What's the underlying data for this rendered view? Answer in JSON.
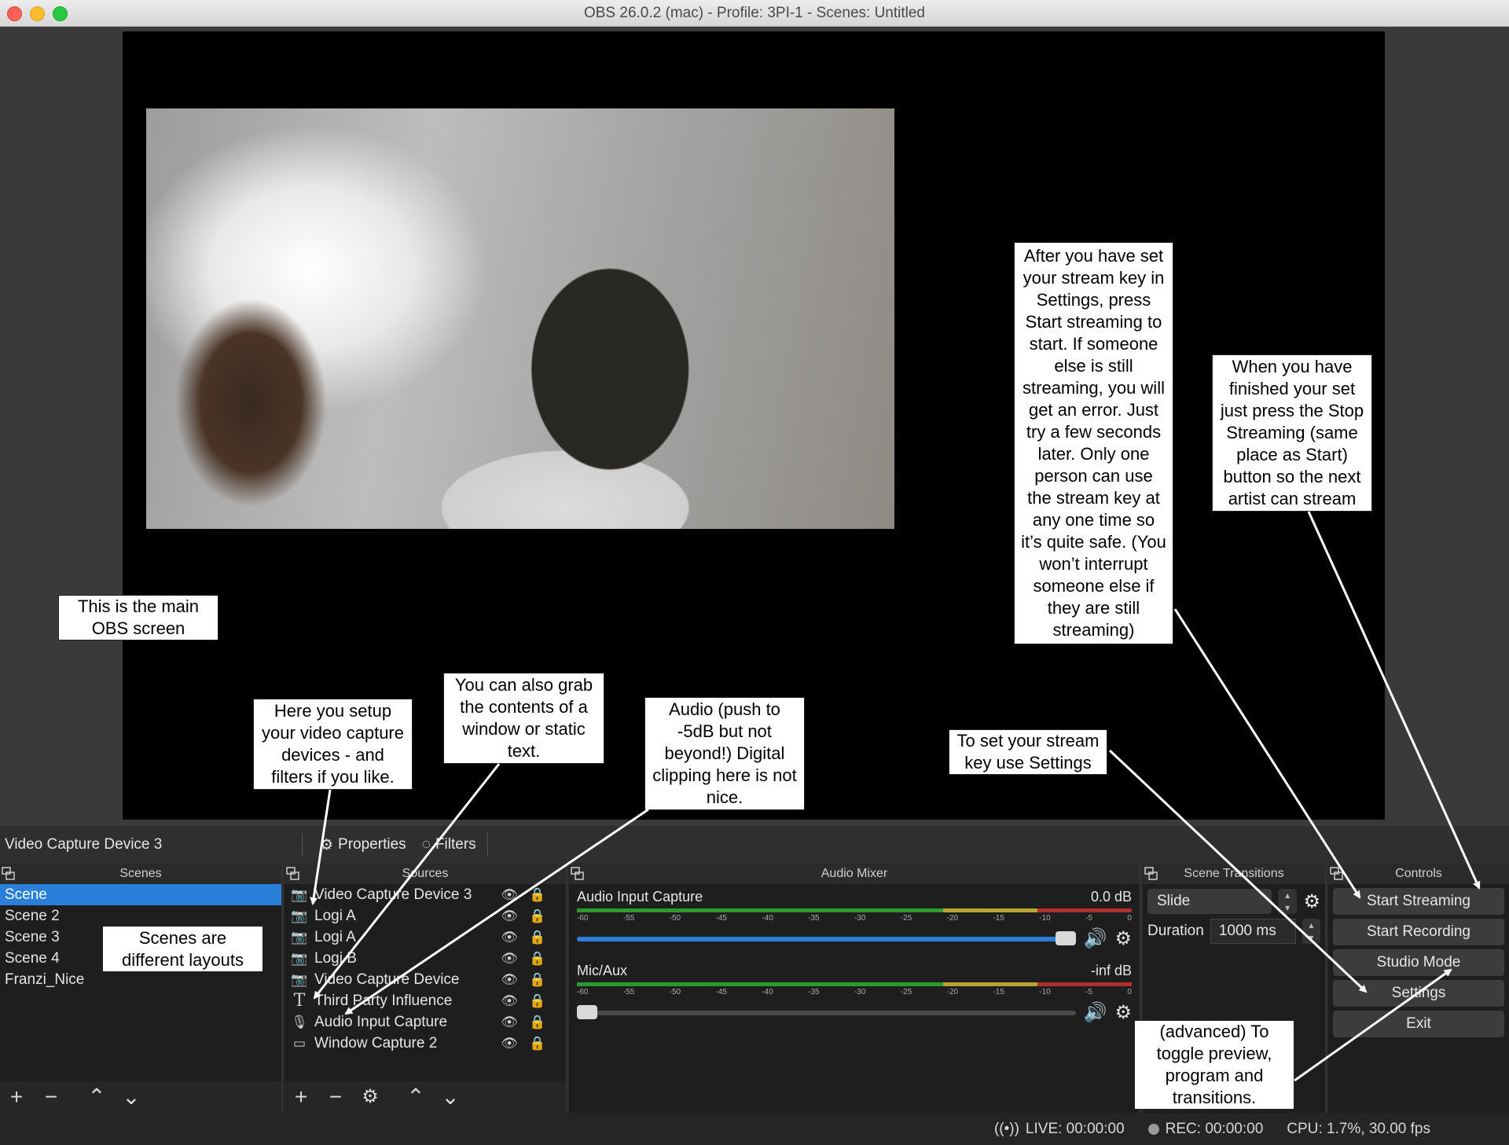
{
  "window": {
    "title": "OBS 26.0.2 (mac) - Profile: 3PI-1 - Scenes: Untitled"
  },
  "annotations": {
    "main_screen": "This is the main\nOBS screen",
    "video_capture": "Here you setup\nyour video capture\ndevices - and\nfilters if you like.",
    "window_grab": "You can also grab\nthe contents of a\nwindow or static\ntext.",
    "audio": "Audio (push to\n-5dB but not\nbeyond!) Digital\nclipping here is not\nnice.",
    "stream_key": "To set your stream\nkey use Settings",
    "start_streaming": "After you have set\nyour stream key in\nSettings, press\nStart streaming to\nstart. If someone\nelse is still\nstreaming, you will\nget an error. Just\ntry a few seconds\nlater. Only one\nperson can use\nthe stream key at\nany one time so\nit’s quite safe. (You\nwon’t interrupt\nsomeone else if\nthey are still\nstreaming)",
    "stop_streaming": "When you have\nfinished your set\njust press the Stop\nStreaming (same\nplace as Start)\nbutton so the next\nartist can stream",
    "scenes": "Scenes are\ndifferent layouts",
    "studio_mode": "(advanced) To\ntoggle preview,\nprogram and\ntransitions."
  },
  "source_bar": {
    "selected_source": "Video Capture Device 3",
    "properties_label": "Properties",
    "filters_label": "Filters"
  },
  "scenes": {
    "title": "Scenes",
    "items": [
      "Scene",
      "Scene 2",
      "Scene 3",
      "Scene 4",
      "Franzi_Nice"
    ],
    "selected_index": 0
  },
  "sources": {
    "title": "Sources",
    "items": [
      {
        "label": "Video Capture Device 3",
        "icon": "camera-icon"
      },
      {
        "label": "Logi A",
        "icon": "camera-icon"
      },
      {
        "label": "Logi A",
        "icon": "camera-icon"
      },
      {
        "label": "Logi B",
        "icon": "camera-icon"
      },
      {
        "label": "Video Capture Device",
        "icon": "camera-icon"
      },
      {
        "label": "Third Party Influence",
        "icon": "text-icon"
      },
      {
        "label": "Audio Input Capture",
        "icon": "microphone-icon"
      },
      {
        "label": "Window Capture 2",
        "icon": "window-icon"
      }
    ]
  },
  "mixer": {
    "title": "Audio Mixer",
    "ticks": [
      "-60",
      "-55",
      "-50",
      "-45",
      "-40",
      "-35",
      "-30",
      "-25",
      "-20",
      "-15",
      "-10",
      "-5",
      "0"
    ],
    "channels": [
      {
        "name": "Audio Input Capture",
        "db": "0.0 dB",
        "volume": 1.0
      },
      {
        "name": "Mic/Aux",
        "db": "-inf dB",
        "volume": 0.0
      }
    ]
  },
  "transitions": {
    "title": "Scene Transitions",
    "selected": "Slide",
    "duration_label": "Duration",
    "duration_value": "1000 ms"
  },
  "controls": {
    "title": "Controls",
    "start_streaming": "Start Streaming",
    "start_recording": "Start Recording",
    "studio_mode": "Studio Mode",
    "settings": "Settings",
    "exit": "Exit"
  },
  "status": {
    "live": "LIVE: 00:00:00",
    "rec": "REC: 00:00:00",
    "cpu": "CPU: 1.7%, 30.00 fps"
  },
  "colors": {
    "selection": "#2a7fdb",
    "panel": "#1e1e1e",
    "preview_bg": "#000000"
  }
}
